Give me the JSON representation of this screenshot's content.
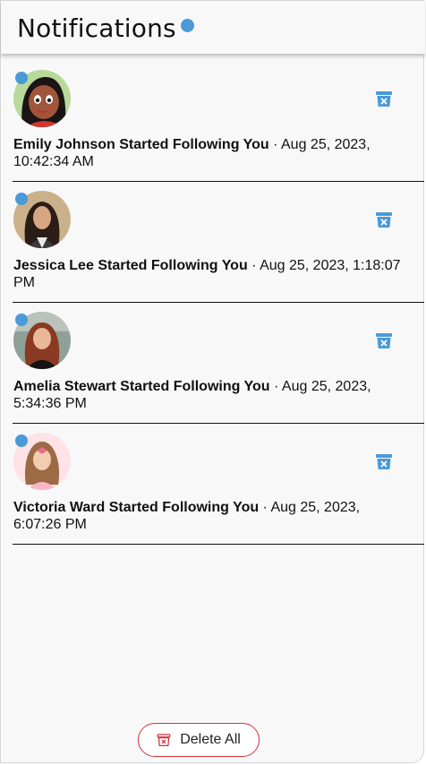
{
  "header": {
    "title": "Notifications"
  },
  "notifications": [
    {
      "name": "Emily Johnson",
      "action": "Started Following You",
      "separator": " · ",
      "date_line": "Aug 25, 2023, 10:42:34 AM",
      "avatar_icon": "cartoon-girl-avatar",
      "unread": true
    },
    {
      "name": "Jessica Lee",
      "action": "Started Following You",
      "separator": " · ",
      "date_line": "Aug 25, 2023, 1:18:07 PM",
      "avatar_icon": "woman-portrait-avatar",
      "unread": true
    },
    {
      "name": "Amelia Stewart",
      "action": "Started Following You",
      "separator": " · ",
      "date_line": "Aug 25, 2023, 5:34:36 PM",
      "avatar_icon": "woman-portrait-avatar",
      "unread": true
    },
    {
      "name": "Victoria Ward",
      "action": "Started Following You",
      "separator": " · ",
      "date_line": "Aug 25, 2023, 6:07:26 PM",
      "avatar_icon": "illustrated-girl-avatar",
      "unread": true
    }
  ],
  "footer": {
    "delete_all_label": "Delete All"
  },
  "colors": {
    "accent_dot": "#4a9ad8",
    "trash_icon": "#4a9ad8",
    "delete_all_border": "#d2323e"
  }
}
